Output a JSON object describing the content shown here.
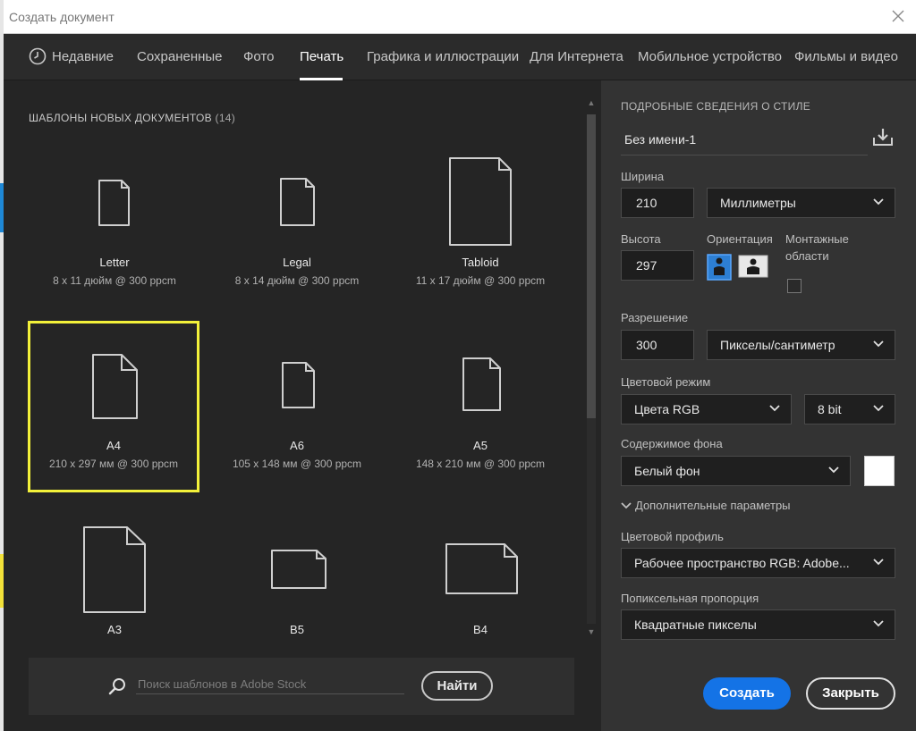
{
  "window": {
    "title": "Создать документ"
  },
  "tabs": [
    {
      "label": "Недавние"
    },
    {
      "label": "Сохраненные"
    },
    {
      "label": "Фото"
    },
    {
      "label": "Печать"
    },
    {
      "label": "Графика и иллюстрации"
    },
    {
      "label": "Для Интернета"
    },
    {
      "label": "Мобильное устройство"
    },
    {
      "label": "Фильмы и видео"
    }
  ],
  "active_tab": "Печать",
  "templates": {
    "heading": "ШАБЛОНЫ НОВЫХ ДОКУМЕНТОВ",
    "count": "(14)",
    "items": [
      {
        "name": "Letter",
        "size": "8 x 11 дюйм @ 300 ppcm"
      },
      {
        "name": "Legal",
        "size": "8 x 14 дюйм @ 300 ppcm"
      },
      {
        "name": "Tabloid",
        "size": "11 x 17 дюйм @ 300 ppcm"
      },
      {
        "name": "A4",
        "size": "210 x 297 мм @ 300 ppcm",
        "selected": true
      },
      {
        "name": "A6",
        "size": "105 x 148 мм @ 300 ppcm"
      },
      {
        "name": "A5",
        "size": "148 x 210 мм @ 300 ppcm"
      },
      {
        "name": "A3",
        "size": ""
      },
      {
        "name": "B5",
        "size": ""
      },
      {
        "name": "B4",
        "size": ""
      }
    ]
  },
  "search": {
    "placeholder": "Поиск шаблонов в Adobe Stock",
    "button": "Найти"
  },
  "details": {
    "heading": "ПОДРОБНЫЕ СВЕДЕНИЯ О СТИЛЕ",
    "doc_name": "Без имени-1",
    "width_label": "Ширина",
    "width_value": "210",
    "width_unit": "Миллиметры",
    "height_label": "Высота",
    "height_value": "297",
    "orientation_label": "Ориентация",
    "artboards_label_1": "Монтажные",
    "artboards_label_2": "области",
    "resolution_label": "Разрешение",
    "resolution_value": "300",
    "resolution_unit": "Пикселы/сантиметр",
    "color_mode_label": "Цветовой режим",
    "color_mode": "Цвета RGB",
    "bit_depth": "8 bit",
    "background_label": "Содержимое фона",
    "background": "Белый фон",
    "advanced": "Дополнительные параметры",
    "profile_label": "Цветовой профиль",
    "profile": "Рабочее пространство RGB: Adobe...",
    "aspect_label": "Попиксельная пропорция",
    "aspect": "Квадратные пикселы"
  },
  "actions": {
    "create": "Создать",
    "close": "Закрыть"
  },
  "colors": {
    "accent": "#1473e6",
    "selection": "#f3f13a",
    "panel": "#333333",
    "grid_bg": "#252525"
  },
  "icons": [
    "clock-icon",
    "close-icon",
    "search-icon",
    "save-preset-icon",
    "chevron-down-icon",
    "portrait-icon",
    "landscape-icon",
    "document-icon"
  ]
}
